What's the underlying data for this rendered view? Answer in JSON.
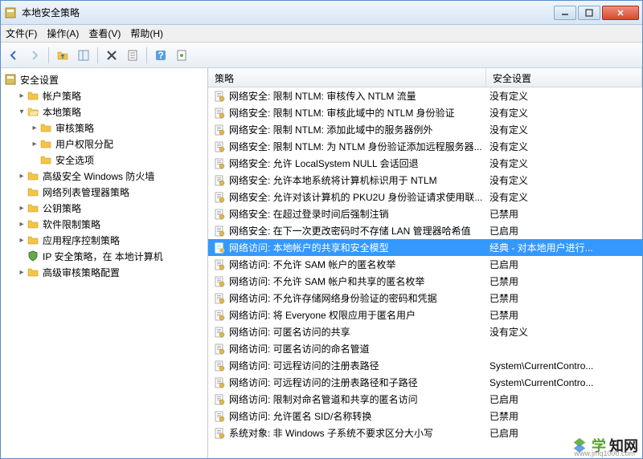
{
  "titlebar": {
    "title": "本地安全策略"
  },
  "menubar": {
    "file": "文件(F)",
    "action": "操作(A)",
    "view": "查看(V)",
    "help": "帮助(H)"
  },
  "tree": {
    "root": "安全设置",
    "items": [
      {
        "label": "帐户策略",
        "indent": 1,
        "twisty": "closed",
        "icon": "folder"
      },
      {
        "label": "本地策略",
        "indent": 1,
        "twisty": "open",
        "icon": "folder-open"
      },
      {
        "label": "审核策略",
        "indent": 2,
        "twisty": "closed",
        "icon": "folder"
      },
      {
        "label": "用户权限分配",
        "indent": 2,
        "twisty": "closed",
        "icon": "folder"
      },
      {
        "label": "安全选项",
        "indent": 2,
        "twisty": "none",
        "icon": "folder",
        "selected": true
      },
      {
        "label": "高级安全 Windows 防火墙",
        "indent": 1,
        "twisty": "closed",
        "icon": "folder"
      },
      {
        "label": "网络列表管理器策略",
        "indent": 1,
        "twisty": "none",
        "icon": "folder"
      },
      {
        "label": "公钥策略",
        "indent": 1,
        "twisty": "closed",
        "icon": "folder"
      },
      {
        "label": "软件限制策略",
        "indent": 1,
        "twisty": "closed",
        "icon": "folder"
      },
      {
        "label": "应用程序控制策略",
        "indent": 1,
        "twisty": "closed",
        "icon": "folder"
      },
      {
        "label": "IP 安全策略，在 本地计算机",
        "indent": 1,
        "twisty": "none",
        "icon": "shield"
      },
      {
        "label": "高级审核策略配置",
        "indent": 1,
        "twisty": "closed",
        "icon": "folder"
      }
    ]
  },
  "list": {
    "columns": {
      "policy": "策略",
      "setting": "安全设置"
    },
    "rows": [
      {
        "policy": "网络安全: 限制 NTLM: 审核传入 NTLM 流量",
        "setting": "没有定义"
      },
      {
        "policy": "网络安全: 限制 NTLM: 审核此域中的 NTLM 身份验证",
        "setting": "没有定义"
      },
      {
        "policy": "网络安全: 限制 NTLM: 添加此域中的服务器例外",
        "setting": "没有定义"
      },
      {
        "policy": "网络安全: 限制 NTLM: 为 NTLM 身份验证添加远程服务器...",
        "setting": "没有定义"
      },
      {
        "policy": "网络安全: 允许 LocalSystem NULL 会话回退",
        "setting": "没有定义"
      },
      {
        "policy": "网络安全: 允许本地系统将计算机标识用于 NTLM",
        "setting": "没有定义"
      },
      {
        "policy": "网络安全: 允许对该计算机的 PKU2U 身份验证请求使用联...",
        "setting": "没有定义"
      },
      {
        "policy": "网络安全: 在超过登录时间后强制注销",
        "setting": "已禁用"
      },
      {
        "policy": "网络安全: 在下一次更改密码时不存储 LAN 管理器哈希值",
        "setting": "已启用"
      },
      {
        "policy": "网络访问: 本地帐户的共享和安全模型",
        "setting": "经典 - 对本地用户进行...",
        "selected": true
      },
      {
        "policy": "网络访问: 不允许 SAM 帐户的匿名枚举",
        "setting": "已启用"
      },
      {
        "policy": "网络访问: 不允许 SAM 帐户和共享的匿名枚举",
        "setting": "已禁用"
      },
      {
        "policy": "网络访问: 不允许存储网络身份验证的密码和凭据",
        "setting": "已禁用"
      },
      {
        "policy": "网络访问: 将 Everyone 权限应用于匿名用户",
        "setting": "已禁用"
      },
      {
        "policy": "网络访问: 可匿名访问的共享",
        "setting": "没有定义"
      },
      {
        "policy": "网络访问: 可匿名访问的命名管道",
        "setting": ""
      },
      {
        "policy": "网络访问: 可远程访问的注册表路径",
        "setting": "System\\CurrentContro..."
      },
      {
        "policy": "网络访问: 可远程访问的注册表路径和子路径",
        "setting": "System\\CurrentContro..."
      },
      {
        "policy": "网络访问: 限制对命名管道和共享的匿名访问",
        "setting": "已启用"
      },
      {
        "policy": "网络访问: 允许匿名 SID/名称转换",
        "setting": "已禁用"
      },
      {
        "policy": "系统对象: 非 Windows 子系统不要求区分大小写",
        "setting": "已启用"
      }
    ]
  },
  "watermark": {
    "text1": "学",
    "text2": "知网",
    "sub": "www.jmq1000.com"
  }
}
